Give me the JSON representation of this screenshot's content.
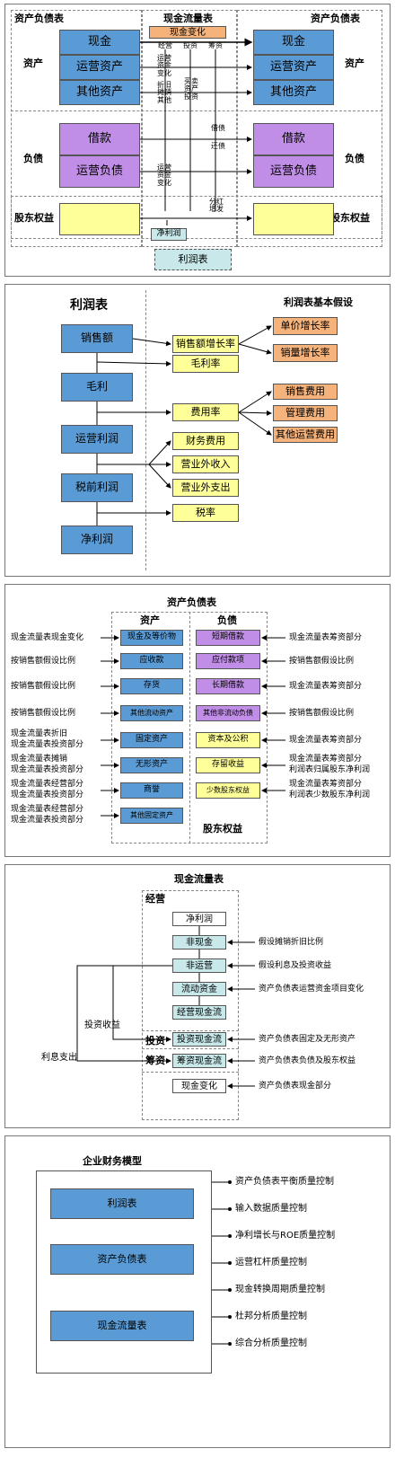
{
  "p1": {
    "bs_left_title": "资产负债表",
    "cf_title": "现金流量表",
    "bs_right_title": "资产负债表",
    "assets_label_left": "资产",
    "assets_label_right": "资产",
    "liab_label_left": "负债",
    "liab_label_right": "负债",
    "equity_label_left": "股东权益",
    "equity_label_right": "股东权益",
    "cash_left": "现金",
    "opassets_left": "运营资产",
    "otherassets_left": "其他资产",
    "cash_right": "现金",
    "opassets_right": "运营资产",
    "otherassets_right": "其他资产",
    "loan_left": "借款",
    "opliab_left": "运营负债",
    "loan_right": "借款",
    "opliab_right": "运营负债",
    "cash_change": "现金变化",
    "col_op": "经营",
    "col_inv": "投资",
    "col_fin": "筹资",
    "op_capital_change": "运营资金变化",
    "dep_amort_other": "折旧摊销其他",
    "buy_sell_assets": "买卖资产投资",
    "borrow": "借债",
    "repay": "还债",
    "op_capital_change2": "运营资金变化",
    "dividend_capital": "分红增发",
    "net_profit": "净利润",
    "income_statement": "利润表"
  },
  "p2": {
    "title_left": "利润表",
    "title_right": "利润表基本假设",
    "sales": "销售额",
    "gross_profit": "毛利",
    "op_profit": "运营利润",
    "pretax_profit": "税前利润",
    "net_profit": "净利润",
    "sales_growth": "销售额增长率",
    "gross_margin": "毛利率",
    "expense_rate": "费用率",
    "fin_expense": "财务费用",
    "nonop_income": "营业外收入",
    "nonop_expense": "营业外支出",
    "tax_rate": "税率",
    "unit_price_growth": "单价增长率",
    "volume_growth": "销量增长率",
    "selling_expense": "销售费用",
    "admin_expense": "管理费用",
    "other_op_expense": "其他运营费用"
  },
  "p3": {
    "title": "资产负债表",
    "assets_header": "资产",
    "liab_header": "负债",
    "equity_footer": "股东权益",
    "assets": [
      "现金及等价物",
      "应收款",
      "存货",
      "其他流动资产",
      "固定资产",
      "无形资产",
      "商誉",
      "其他固定资产"
    ],
    "liabs": [
      "短期借款",
      "应付款项",
      "长期借款",
      "其他非流动负债",
      "资本及公积",
      "存留收益",
      "少数股东权益"
    ],
    "left_notes": [
      "现金流量表现金变化",
      "按销售额假设比例",
      "按销售额假设比例",
      "按销售额假设比例",
      "现金流量表折旧",
      "现金流量表投资部分",
      "现金流量表摊销",
      "现金流量表投资部分",
      "现金流量表经营部分",
      "现金流量表投资部分",
      "现金流量表经营部分",
      "现金流量表投资部分"
    ],
    "right_notes": [
      "现金流量表筹资部分",
      "按销售额假设比例",
      "现金流量表筹资部分",
      "按销售额假设比例",
      "现金流量表筹资部分",
      "现金流量表筹资部分",
      "利润表归属股东净利润",
      "现金流量表筹资部分",
      "利润表少数股东净利润"
    ]
  },
  "p4": {
    "title": "现金流量表",
    "op_section": "经营",
    "inv_section": "投资",
    "fin_section": "筹资",
    "net_profit": "净利润",
    "non_cash": "非现金",
    "non_op": "非运营",
    "working_capital": "流动资金",
    "op_cash_flow": "经营现金流",
    "inv_cash_flow": "投资现金流",
    "fin_cash_flow": "筹资现金流",
    "cash_change": "现金变化",
    "inv_income": "投资收益",
    "interest_expense": "利息支出",
    "notes": [
      "假设摊销折旧比例",
      "假设利息及投资收益",
      "资产负债表运营资金项目变化",
      "资产负债表固定及无形资产",
      "资产负债表负债及股东权益",
      "资产负债表现金部分"
    ]
  },
  "p5": {
    "title": "企业财务模型",
    "income_statement": "利润表",
    "balance_sheet": "资产负债表",
    "cash_flow": "现金流量表",
    "checks": [
      "资产负债表平衡质量控制",
      "输入数据质量控制",
      "净利增长与ROE质量控制",
      "运营杠杆质量控制",
      "现金转换周期质量控制",
      "杜邦分析质量控制",
      "综合分析质量控制"
    ]
  }
}
